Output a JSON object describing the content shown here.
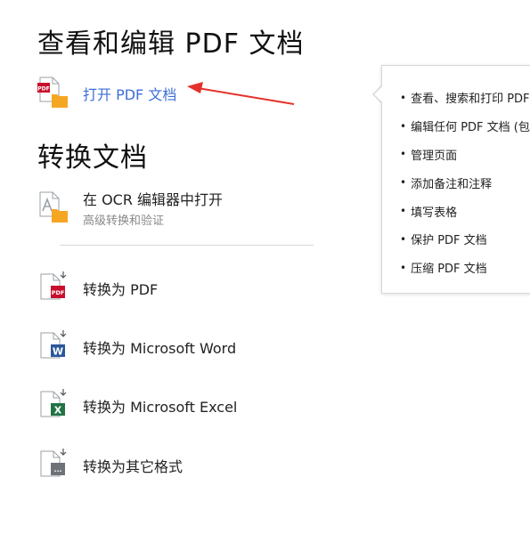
{
  "sections": {
    "view_edit": {
      "title": "查看和编辑 PDF 文档"
    },
    "convert": {
      "title": "转换文档"
    }
  },
  "actions": {
    "open_pdf": {
      "label": "打开 PDF 文档",
      "icon": "pdf-folder-icon",
      "color": "#3d6fd8"
    },
    "open_ocr": {
      "label": "在 OCR 编辑器中打开",
      "sublabel": "高级转换和验证",
      "icon": "ocr-folder-icon"
    },
    "to_pdf": {
      "label": "转换为 PDF",
      "icon": "convert-pdf-icon",
      "badge": "PDF",
      "badge_color": "#c8102e"
    },
    "to_word": {
      "label": "转换为 Microsoft Word",
      "icon": "convert-word-icon",
      "badge": "W",
      "badge_color": "#2b579a"
    },
    "to_excel": {
      "label": "转换为 Microsoft Excel",
      "icon": "convert-excel-icon",
      "badge": "X",
      "badge_color": "#217346"
    },
    "to_other": {
      "label": "转换为其它格式",
      "icon": "convert-other-icon",
      "badge": "...",
      "badge_color": "#6d7379"
    }
  },
  "popup": {
    "items": [
      {
        "label": "查看、搜索和打印 PDF"
      },
      {
        "label": "编辑任何 PDF 文档 (包"
      },
      {
        "label": "管理页面"
      },
      {
        "label": "添加备注和注释"
      },
      {
        "label": "填写表格"
      },
      {
        "label": "保护 PDF 文档"
      },
      {
        "label": "压缩 PDF 文档"
      }
    ]
  },
  "annotation": {
    "arrow_color": "#e4312b"
  }
}
